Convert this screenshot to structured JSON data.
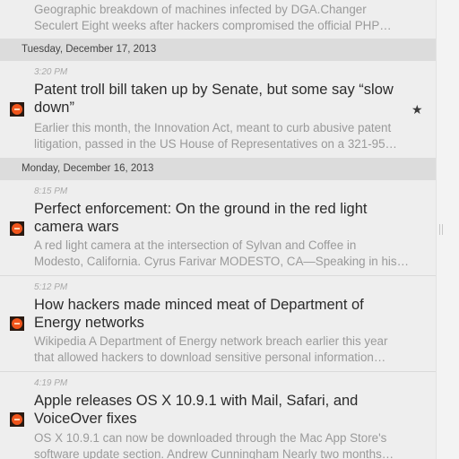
{
  "top_item": {
    "snippet_lines": [
      "Geographic breakdown of machines infected by DGA.Changer",
      "Seculert Eight weeks after hackers compromised the official PHP…"
    ]
  },
  "date_headers": [
    "Tuesday, December 17, 2013",
    "Monday, December 16, 2013"
  ],
  "articles": [
    {
      "time": "3:20 PM",
      "title": "Patent troll bill taken up by Senate, but some say “slow down”",
      "snippet_lines": [
        "Earlier this month, the Innovation Act, meant to curb abusive patent",
        "litigation, passed in the US House of Representatives on a 321-95…"
      ],
      "starred": true,
      "icon": "ars-technica-favicon"
    },
    {
      "time": "8:15 PM",
      "title": "Perfect enforcement: On the ground in the red light camera wars",
      "snippet_lines": [
        "A red light camera at the intersection of Sylvan and Coffee in",
        "Modesto, California. Cyrus Farivar MODESTO, CA—Speaking in his…"
      ],
      "starred": false,
      "icon": "ars-technica-favicon"
    },
    {
      "time": "5:12 PM",
      "title": "How hackers made minced meat of Department of Energy networks",
      "snippet_lines": [
        "Wikipedia A Department of Energy network breach earlier this year",
        "that allowed hackers to download sensitive personal information…"
      ],
      "starred": false,
      "icon": "ars-technica-favicon"
    },
    {
      "time": "4:19 PM",
      "title": "Apple releases OS X 10.9.1 with Mail, Safari, and VoiceOver fixes",
      "snippet_lines": [
        "OS X 10.9.1 can now be downloaded through the Mac App Store's",
        "software update section. Andrew Cunningham Nearly two months…"
      ],
      "starred": false,
      "icon": "ars-technica-favicon"
    }
  ],
  "star_icon": "★",
  "colors": {
    "background": "#eeeeee",
    "date_header_bg": "#dcdcdc",
    "title_text": "#2b2b2b",
    "snippet_text": "#9a9a9a",
    "favicon_orange": "#f0551c"
  }
}
